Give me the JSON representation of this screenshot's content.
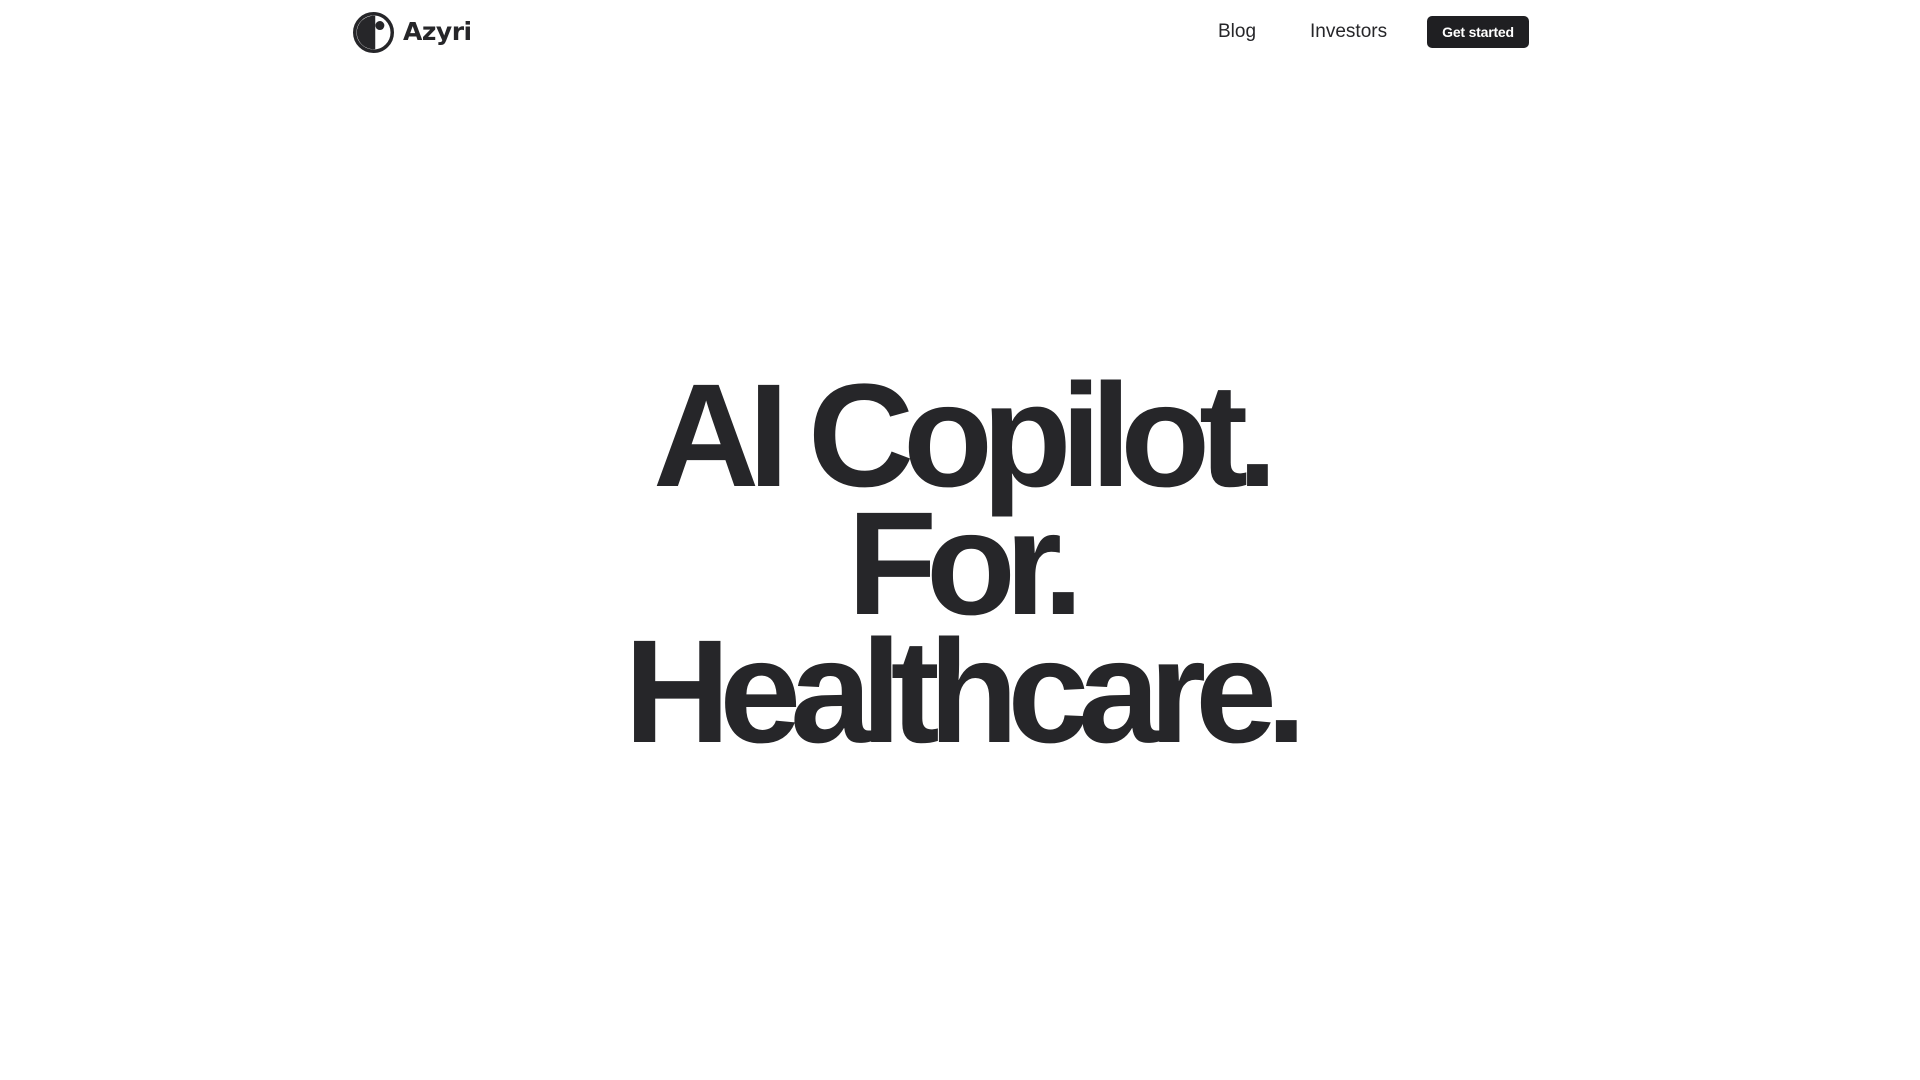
{
  "brand": {
    "name": "Azyri",
    "logo_icon": "azyri-logo-mark"
  },
  "nav": {
    "items": [
      {
        "label": "Blog"
      },
      {
        "label": "Investors"
      }
    ],
    "cta_label": "Get started"
  },
  "hero": {
    "lines": [
      "AI Copilot.",
      "For.",
      "Healthcare."
    ]
  },
  "colors": {
    "text": "#262629",
    "button_bg": "#1f1f22",
    "button_text": "#ffffff",
    "background": "#ffffff"
  }
}
